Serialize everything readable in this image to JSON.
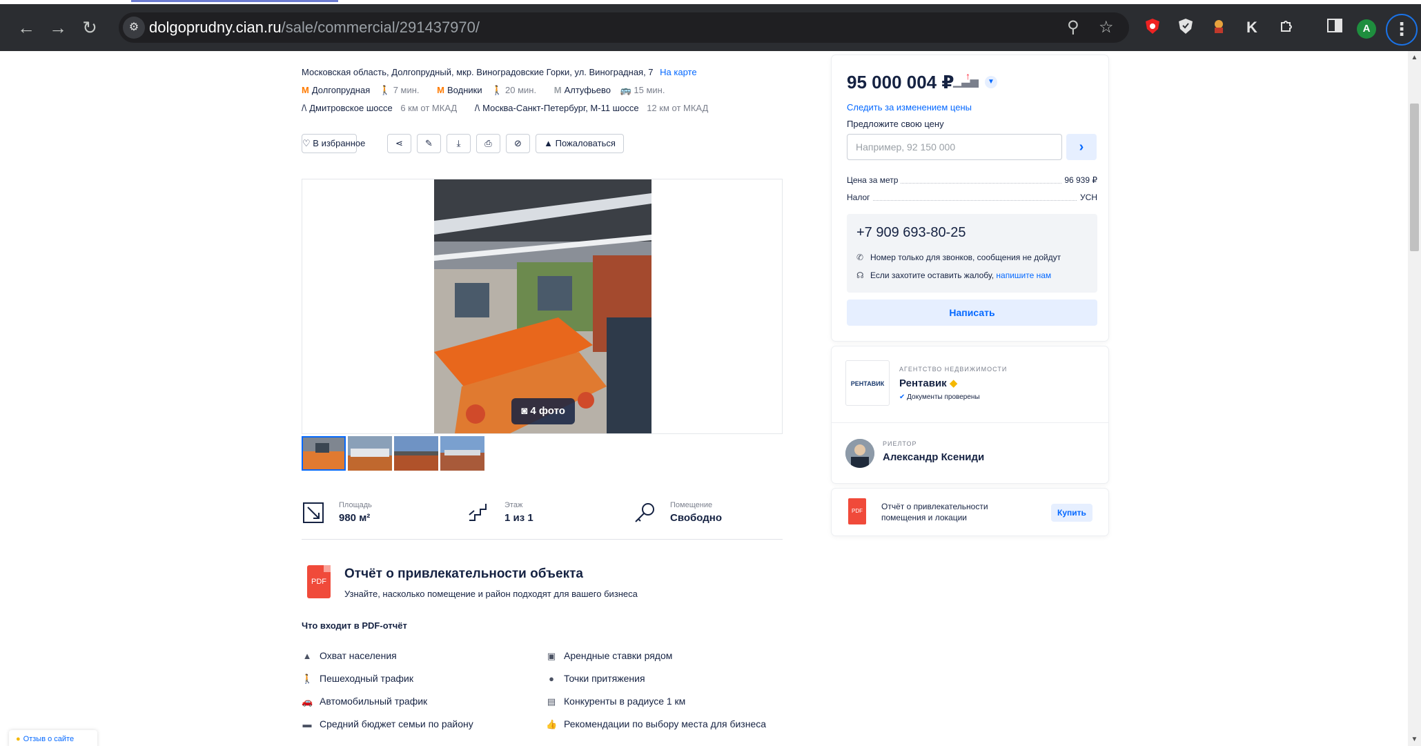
{
  "browser": {
    "url_host": "dolgoprudny.cian.ru",
    "url_path": "/sale/commercial/291437970/",
    "back_icon": "←",
    "forward_icon": "→",
    "reload_icon": "↻",
    "site_info_icon": "⚙",
    "zoom_icon": "⚲",
    "star_icon": "☆",
    "ext_k_label": "K",
    "avatar_letter": "A",
    "menu_icon": "⋮"
  },
  "listing": {
    "address": "Московская область, Долгопрудный, мкр. Виноградовские Горки, ул. Виноградная, 7",
    "map_link": "На карте",
    "metro": [
      {
        "name": "Долгопрудная",
        "time": "7 мин.",
        "mode_icon": "🚶"
      },
      {
        "name": "Водники",
        "time": "20 мин.",
        "mode_icon": "🚶"
      },
      {
        "name": "Алтуфьево",
        "time": "15 мин.",
        "mode_icon": "🚌"
      }
    ],
    "highways": [
      {
        "name": "Дмитровское шоссе",
        "dist": "6 км от МКАД"
      },
      {
        "name": "Москва-Санкт-Петербург, М-11 шоссе",
        "dist": "12 км от МКАД"
      }
    ],
    "actions": {
      "favorite": "В избранное",
      "complain": "Пожаловаться"
    },
    "photo_count": "4 фото",
    "features": [
      {
        "label": "Площадь",
        "value": "980 м²"
      },
      {
        "label": "Этаж",
        "value": "1 из 1"
      },
      {
        "label": "Помещение",
        "value": "Свободно"
      }
    ]
  },
  "report": {
    "pdf_label": "PDF",
    "title": "Отчёт о привлекательности объекта",
    "subtitle": "Узнайте, насколько помещение и район подходят для вашего бизнеса",
    "list_heading": "Что входит в PDF-отчёт",
    "items_left": [
      "Охват населения",
      "Пешеходный трафик",
      "Автомобильный трафик",
      "Средний бюджет семьи по району"
    ],
    "items_right": [
      "Арендные ставки рядом",
      "Точки притяжения",
      "Конкуренты в радиусе 1 км",
      "Рекомендации по выбору места для бизнеса"
    ]
  },
  "sidebar": {
    "price": "95 000 004 ₽",
    "follow_link": "Следить за изменением цены",
    "offer_label": "Предложите свою цену",
    "offer_placeholder": "Например, 92 150 000",
    "price_per_meter_label": "Цена за метр",
    "price_per_meter_value": "96 939 ₽",
    "tax_label": "Налог",
    "tax_value": "УСН",
    "phone": "+7 909 693-80-25",
    "phone_note": "Номер только для звонков, сообщения не дойдут",
    "complaint_note_prefix": "Если захотите оставить жалобу,",
    "complaint_link": "напишите нам",
    "write_button": "Написать",
    "agency_type": "Агентство недвижимости",
    "agency_name": "Рентавик",
    "agency_logo_text": "РЕНТАВИК",
    "agency_verified": "Документы проверены",
    "realtor_type": "Риелтор",
    "realtor_name": "Александр Ксениди",
    "buy_report_text": "Отчёт о привлекательности помещения и локации",
    "buy_button": "Купить"
  },
  "feedback_label": "Отзыв о сайте",
  "colors": {
    "accent": "#0468ff",
    "metro": "#ff7a00",
    "pdf": "#f04a3a",
    "chrome": "#2b2d31"
  }
}
